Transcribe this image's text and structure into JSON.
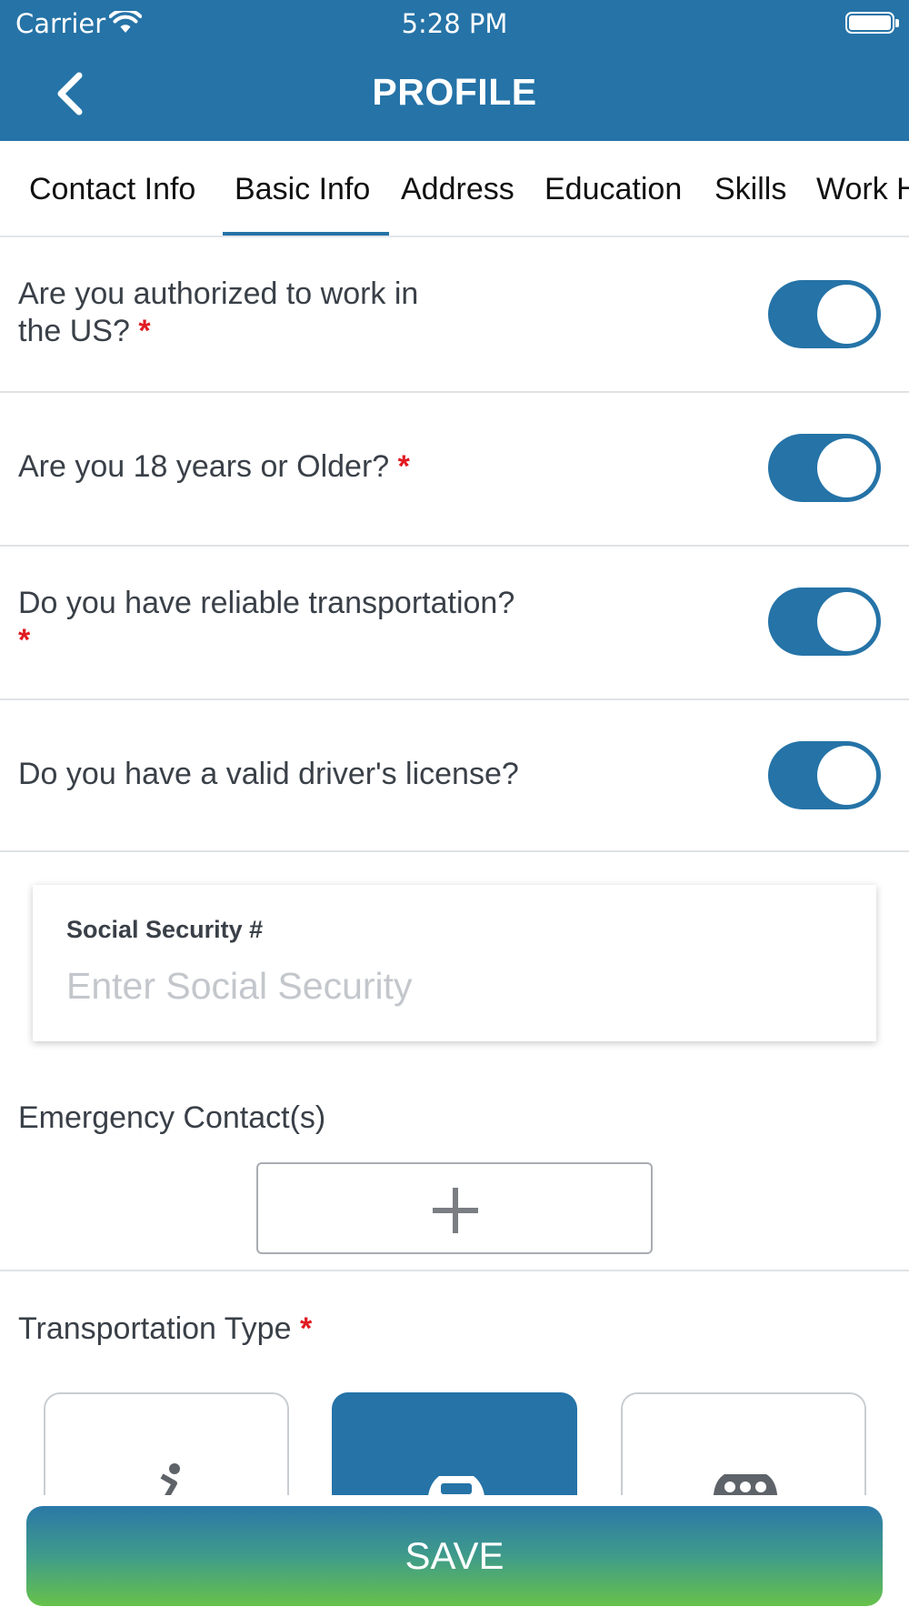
{
  "status_bar": {
    "carrier": "Carrier",
    "time": "5:28 PM"
  },
  "header": {
    "title": "PROFILE"
  },
  "tabs": [
    {
      "label": "Contact Info",
      "active": false
    },
    {
      "label": "Basic Info",
      "active": true
    },
    {
      "label": "Address",
      "active": false
    },
    {
      "label": "Education",
      "active": false
    },
    {
      "label": "Skills",
      "active": false
    },
    {
      "label": "Work History",
      "active": false
    }
  ],
  "questions": [
    {
      "line1": "Are you authorized to work in",
      "line2": "the US?",
      "required": "*",
      "value": true
    },
    {
      "text": "Are you 18 years or Older?",
      "required": "*",
      "value": true
    },
    {
      "text": "Do you have reliable transportation?",
      "required": "*",
      "value": true
    },
    {
      "text": "Do you have a valid driver's license?",
      "value": true
    }
  ],
  "ssn": {
    "label": "Social Security #",
    "value": "",
    "placeholder": "Enter Social Security"
  },
  "emergency": {
    "label": "Emergency Contact(s)"
  },
  "transportation": {
    "label": "Transportation Type",
    "required": "*",
    "options": [
      {
        "icon": "bicycle-icon",
        "selected": false
      },
      {
        "icon": "car-icon",
        "selected": true
      },
      {
        "icon": "carpool-icon",
        "selected": false
      }
    ]
  },
  "save": {
    "label": "SAVE"
  },
  "colors": {
    "primary": "#2573a7",
    "required": "#e11b22",
    "save_gradient_start": "#2b78a8",
    "save_gradient_end": "#67c24a"
  }
}
